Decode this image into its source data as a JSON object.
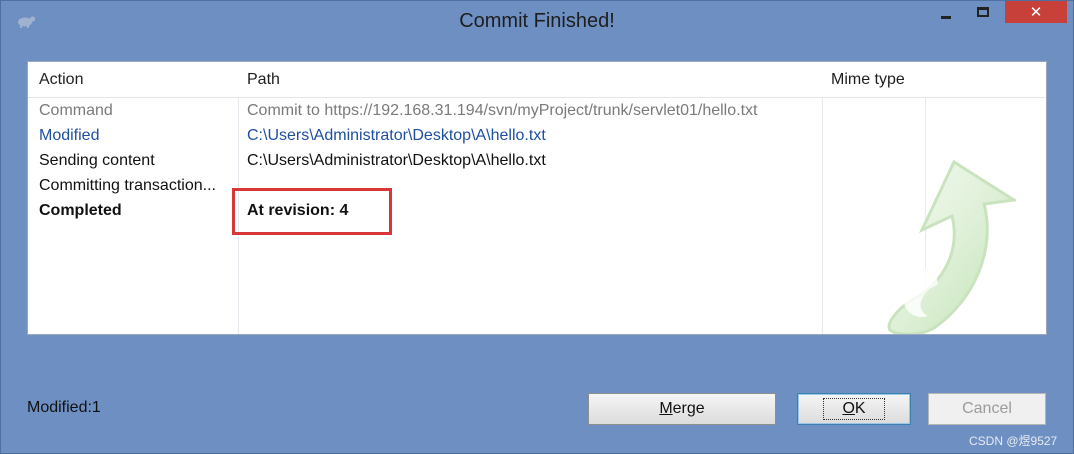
{
  "window": {
    "title": "Commit Finished!",
    "close_icon": "close-icon",
    "app_icon": "tortoise-svn-icon"
  },
  "list": {
    "columns": [
      "Action",
      "Path",
      "Mime type"
    ],
    "rows": [
      {
        "action": "Command",
        "path": "Commit to https://192.168.31.194/svn/myProject/trunk/servlet01/hello.txt",
        "style": "gray"
      },
      {
        "action": "Modified",
        "path": "C:\\Users\\Administrator\\Desktop\\A\\hello.txt",
        "style": "blue"
      },
      {
        "action": "Sending content",
        "path": "C:\\Users\\Administrator\\Desktop\\A\\hello.txt",
        "style": "black"
      },
      {
        "action": "Committing transaction...",
        "path": "",
        "style": "black"
      },
      {
        "action": "Completed",
        "path": "At revision: 4",
        "style": "bold"
      }
    ]
  },
  "status": {
    "text": "Modified:1"
  },
  "buttons": {
    "merge_prefix": "M",
    "merge_rest": "erge",
    "ok_prefix": "O",
    "ok_rest": "K",
    "cancel": "Cancel"
  },
  "colors": {
    "highlight": "#d9363a",
    "link_blue": "#1f4fa0",
    "background": "#6e8fc2"
  },
  "watermark": "CSDN @煜9527"
}
